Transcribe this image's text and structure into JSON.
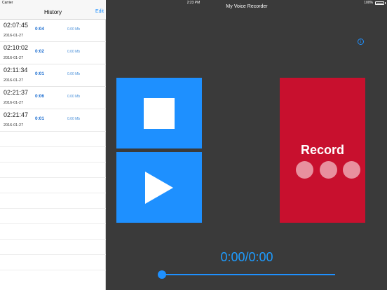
{
  "status_bar": {
    "carrier": "Carrier",
    "time": "2:23 PM",
    "battery": "100%"
  },
  "history": {
    "title": "History",
    "edit_label": "Edit",
    "items": [
      {
        "time": "02:07:45",
        "date": "2016-01-27",
        "duration": "0:04",
        "size": "0.00 Mb"
      },
      {
        "time": "02:10:02",
        "date": "2016-01-27",
        "duration": "0:02",
        "size": "0.00 Mb"
      },
      {
        "time": "02:11:34",
        "date": "2016-01-27",
        "duration": "0:01",
        "size": "0.00 Mb"
      },
      {
        "time": "02:21:37",
        "date": "2016-01-27",
        "duration": "0:06",
        "size": "0.00 Mb"
      },
      {
        "time": "02:21:47",
        "date": "2016-01-27",
        "duration": "0:01",
        "size": "0.00 Mb"
      }
    ]
  },
  "recorder": {
    "title": "My Voice Recorder",
    "info_icon": "i",
    "record_label": "Record",
    "timer": "0:00/0:00",
    "playback_progress": 0
  },
  "colors": {
    "accent": "#1e90ff",
    "record": "#c8102e",
    "background": "#3a3a3a"
  }
}
